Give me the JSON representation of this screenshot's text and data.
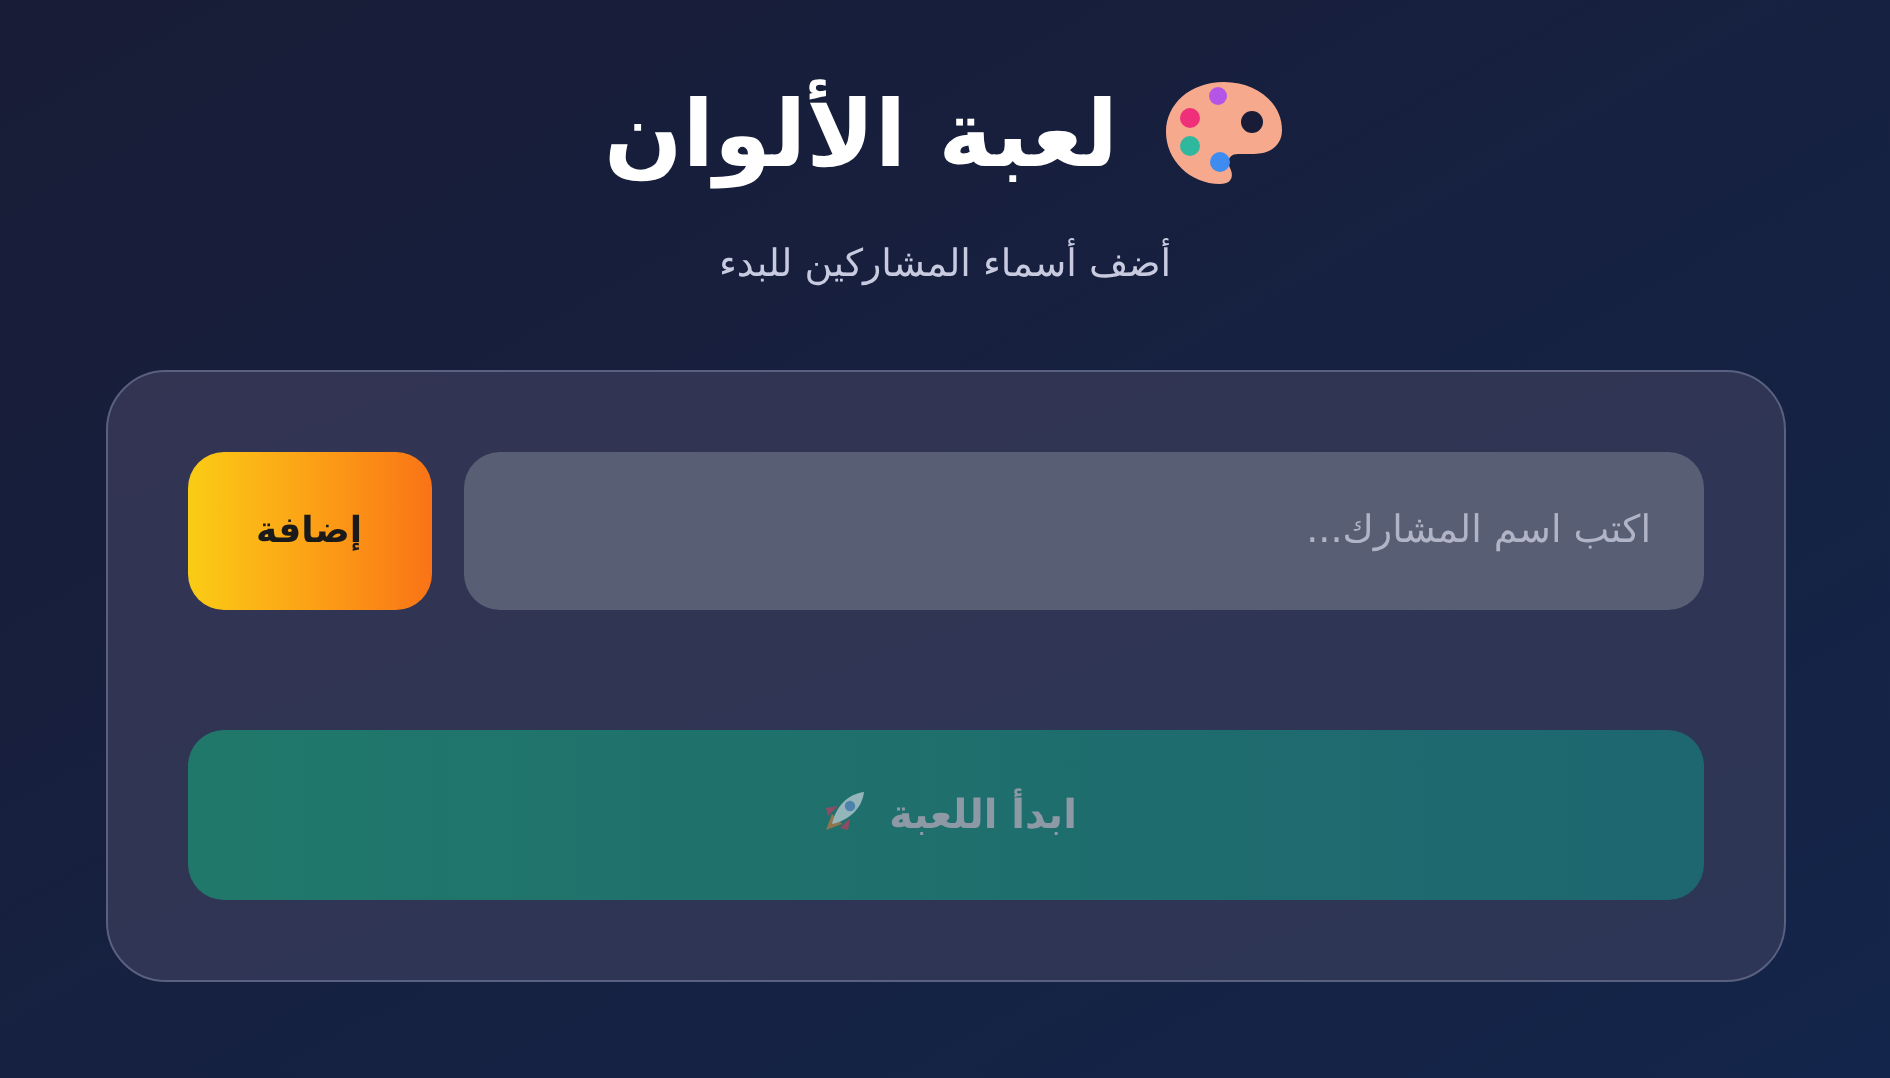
{
  "header": {
    "title": "لعبة الألوان",
    "subtitle": "أضف أسماء المشاركين للبدء"
  },
  "form": {
    "name_field": {
      "placeholder": "اكتب اسم المشارك..."
    },
    "add_button": {
      "label": "إضافة"
    }
  },
  "start_button": {
    "label": "ابدأ اللعبة",
    "disabled": true
  }
}
